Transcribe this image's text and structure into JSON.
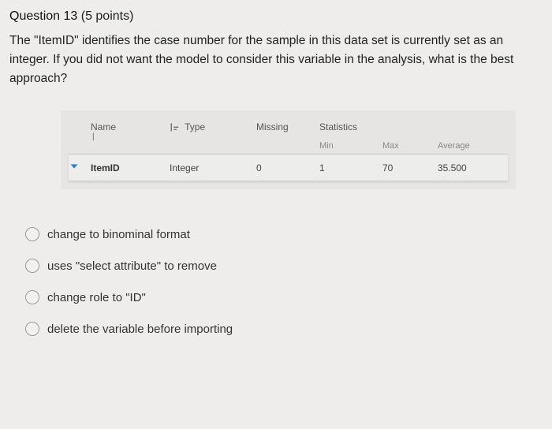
{
  "question": {
    "number_label": "Question 13",
    "points_label": "(5 points)",
    "body": "The \"ItemID\" identifies the case number for the sample in this data set is currently set as an integer.  If you did not want the model to consider this variable in the analysis, what is the best approach?"
  },
  "table": {
    "headers": {
      "name": "Name",
      "type": "Type",
      "missing": "Missing",
      "statistics": "Statistics"
    },
    "sub_headers": {
      "min": "Min",
      "max": "Max",
      "avg": "Average"
    },
    "row": {
      "name": "ItemID",
      "type": "Integer",
      "missing": "0",
      "min": "1",
      "max": "70",
      "avg": "35.500"
    }
  },
  "options": {
    "a": "change to binominal format",
    "b": "uses \"select attribute\" to remove",
    "c": "change role to \"ID\"",
    "d": "delete the variable before importing"
  }
}
